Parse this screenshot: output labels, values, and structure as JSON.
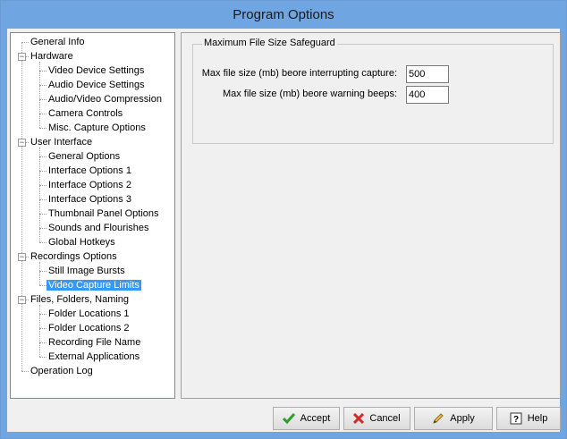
{
  "window": {
    "title": "Program Options"
  },
  "tree": {
    "items": [
      {
        "label": "General Info",
        "level": 0,
        "expander": ""
      },
      {
        "label": "Hardware",
        "level": 0,
        "expander": "minus"
      },
      {
        "label": "Video Device Settings",
        "level": 1,
        "expander": ""
      },
      {
        "label": "Audio Device Settings",
        "level": 1,
        "expander": ""
      },
      {
        "label": "Audio/Video Compression",
        "level": 1,
        "expander": ""
      },
      {
        "label": "Camera Controls",
        "level": 1,
        "expander": ""
      },
      {
        "label": "Misc. Capture Options",
        "level": 1,
        "expander": ""
      },
      {
        "label": "User Interface",
        "level": 0,
        "expander": "minus"
      },
      {
        "label": "General Options",
        "level": 1,
        "expander": ""
      },
      {
        "label": "Interface Options 1",
        "level": 1,
        "expander": ""
      },
      {
        "label": "Interface Options 2",
        "level": 1,
        "expander": ""
      },
      {
        "label": "Interface Options 3",
        "level": 1,
        "expander": ""
      },
      {
        "label": "Thumbnail Panel Options",
        "level": 1,
        "expander": ""
      },
      {
        "label": "Sounds and Flourishes",
        "level": 1,
        "expander": ""
      },
      {
        "label": "Global Hotkeys",
        "level": 1,
        "expander": ""
      },
      {
        "label": "Recordings Options",
        "level": 0,
        "expander": "minus"
      },
      {
        "label": "Still Image Bursts",
        "level": 1,
        "expander": ""
      },
      {
        "label": "Video Capture Limits",
        "level": 1,
        "expander": "",
        "selected": true
      },
      {
        "label": "Files, Folders, Naming",
        "level": 0,
        "expander": "minus"
      },
      {
        "label": "Folder Locations 1",
        "level": 1,
        "expander": ""
      },
      {
        "label": "Folder Locations 2",
        "level": 1,
        "expander": ""
      },
      {
        "label": "Recording File Name",
        "level": 1,
        "expander": ""
      },
      {
        "label": "External Applications",
        "level": 1,
        "expander": ""
      },
      {
        "label": "Operation Log",
        "level": 0,
        "expander": ""
      }
    ]
  },
  "groupbox": {
    "title": "Maximum File Size Safeguard",
    "fields": [
      {
        "label": "Max file size (mb) beore interrupting capture:",
        "value": "500"
      },
      {
        "label": "Max file size (mb) beore warning beeps:",
        "value": "400"
      }
    ]
  },
  "buttons": {
    "accept": "Accept",
    "cancel": "Cancel",
    "apply": "Apply",
    "help": "Help"
  }
}
